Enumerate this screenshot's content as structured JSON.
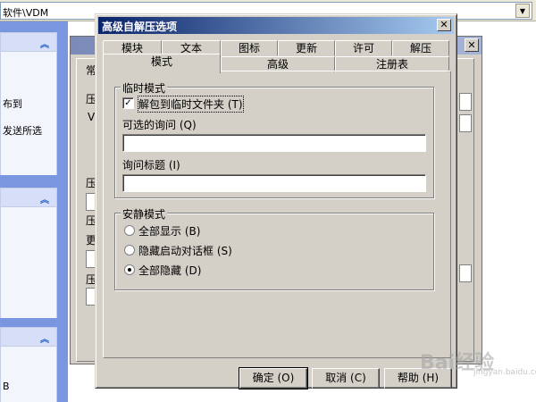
{
  "explorer": {
    "address_text": "软件\\VDM",
    "panels": [
      {
        "lines": [
          "布到",
          "发送所选"
        ]
      },
      {
        "lines": []
      },
      {
        "lines": [
          "B"
        ]
      }
    ]
  },
  "back_window": {
    "fragments": [
      "常",
      "压",
      "V",
      "压",
      "压",
      "更",
      "压"
    ]
  },
  "dialog": {
    "title": "高级自解压选项",
    "close_glyph": "✕",
    "tabs_row1": [
      "模块",
      "文本",
      "图标",
      "更新",
      "许可",
      "解压"
    ],
    "tabs_row2": [
      "模式",
      "高级",
      "注册表"
    ],
    "temp_group": {
      "legend": "临时模式",
      "unpack_checkbox": {
        "label": "解包到临时文件夹 (T)",
        "checked": true
      },
      "optional_prompt_label": "可选的询问 (Q)",
      "optional_prompt_value": "",
      "prompt_title_label": "询问标题 (I)",
      "prompt_title_value": ""
    },
    "silent_group": {
      "legend": "安静模式",
      "options": [
        {
          "label": "全部显示 (B)",
          "selected": false
        },
        {
          "label": "隐藏启动对话框 (S)",
          "selected": false
        },
        {
          "label": "全部隐藏 (D)",
          "selected": true
        }
      ]
    },
    "buttons": {
      "ok": "确定 (O)",
      "cancel": "取消 (C)",
      "help": "帮助 (H)"
    }
  },
  "watermark": {
    "text": "Bai经验",
    "sub": "jingyan.baidu.com"
  }
}
